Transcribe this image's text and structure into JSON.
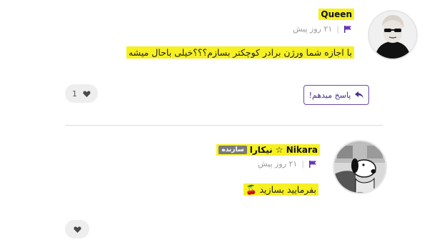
{
  "comments": [
    {
      "username": "Queen",
      "time": "۲۱ روز پیش",
      "text": "با اجازه شما ورژن برادر کوچکتر بسازم؟؟؟خیلی باحال میشه",
      "likes": "1",
      "reply_label": "پاسخ میدهم!"
    },
    {
      "username": "Nikara ☆ نیکارا",
      "badge": "سازنده",
      "time": "۲۱ روز پیش",
      "text": "بفرمایید بسازید 🍒",
      "likes": ""
    }
  ],
  "colors": {
    "highlight": "#f6f021",
    "accent": "#6b4aa8",
    "badge": "#7b7b7b"
  },
  "icons": {
    "flag": "flag-icon",
    "heart": "heart-icon",
    "reply": "reply-arrow-icon"
  }
}
